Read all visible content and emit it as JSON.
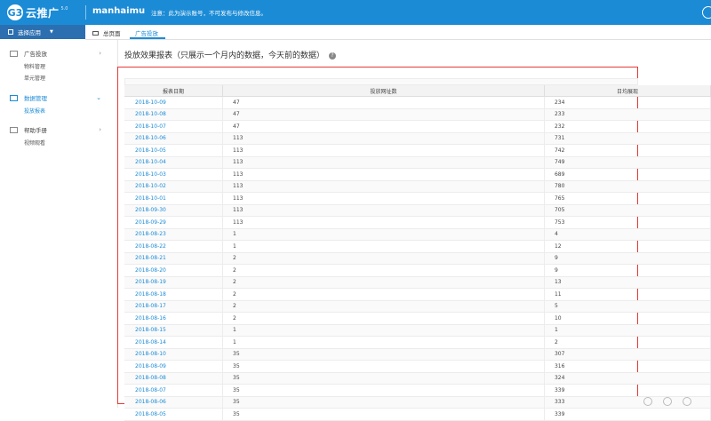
{
  "header": {
    "logo_mark": "G3",
    "logo_text": "云推广",
    "logo_version": "5.0",
    "username": "manhaimu",
    "notice": "注意：此为演示账号，不可发布与修改信息。"
  },
  "sidebar": {
    "app_select_label": "选择应用",
    "groups": [
      {
        "label": "广告投放",
        "items": [
          "物料管理",
          "单元管理"
        ]
      },
      {
        "label": "数据管理",
        "items": [
          "投放报表"
        ]
      },
      {
        "label": "帮助手册",
        "items": [
          "视频观看"
        ]
      }
    ]
  },
  "tabs": {
    "home": "总页面",
    "ad": "广告投放"
  },
  "page": {
    "title": "投放效果报表（只展示一个月内的数据，今天前的数据）",
    "help": "?"
  },
  "table": {
    "headers": [
      "报表日期",
      "投放网址数",
      "日均展现"
    ],
    "rows": [
      [
        "2018-10-09",
        "47",
        "234"
      ],
      [
        "2018-10-08",
        "47",
        "233"
      ],
      [
        "2018-10-07",
        "47",
        "232"
      ],
      [
        "2018-10-06",
        "113",
        "731"
      ],
      [
        "2018-10-05",
        "113",
        "742"
      ],
      [
        "2018-10-04",
        "113",
        "749"
      ],
      [
        "2018-10-03",
        "113",
        "689"
      ],
      [
        "2018-10-02",
        "113",
        "780"
      ],
      [
        "2018-10-01",
        "113",
        "765"
      ],
      [
        "2018-09-30",
        "113",
        "705"
      ],
      [
        "2018-09-29",
        "113",
        "753"
      ],
      [
        "2018-08-23",
        "1",
        "4"
      ],
      [
        "2018-08-22",
        "1",
        "12"
      ],
      [
        "2018-08-21",
        "2",
        "9"
      ],
      [
        "2018-08-20",
        "2",
        "9"
      ],
      [
        "2018-08-19",
        "2",
        "13"
      ],
      [
        "2018-08-18",
        "2",
        "11"
      ],
      [
        "2018-08-17",
        "2",
        "5"
      ],
      [
        "2018-08-16",
        "2",
        "10"
      ],
      [
        "2018-08-15",
        "1",
        "1"
      ],
      [
        "2018-08-14",
        "1",
        "2"
      ],
      [
        "2018-08-10",
        "35",
        "307"
      ],
      [
        "2018-08-09",
        "35",
        "316"
      ],
      [
        "2018-08-08",
        "35",
        "324"
      ],
      [
        "2018-08-07",
        "35",
        "339"
      ],
      [
        "2018-08-06",
        "35",
        "333"
      ],
      [
        "2018-08-05",
        "35",
        "339"
      ]
    ]
  }
}
